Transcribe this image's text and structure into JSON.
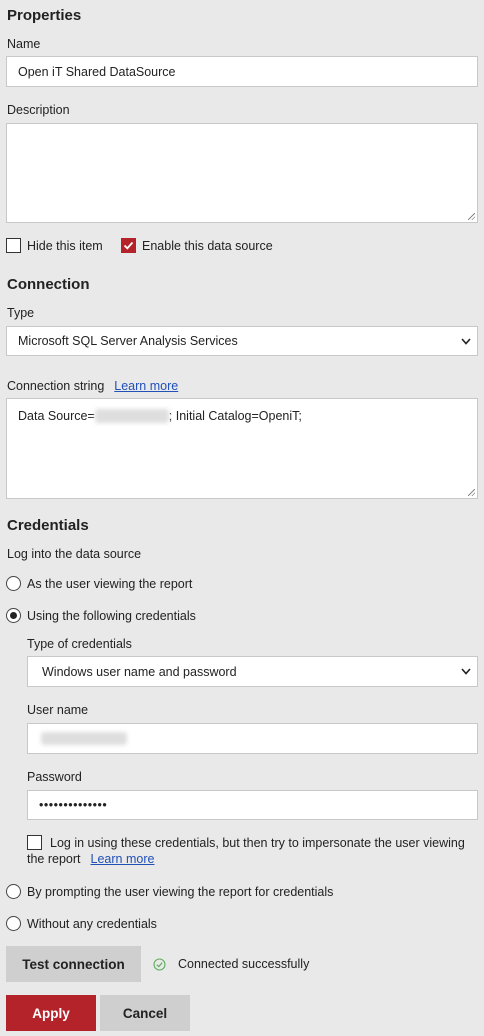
{
  "properties": {
    "heading": "Properties",
    "name_label": "Name",
    "name_value": "Open iT Shared DataSource",
    "description_label": "Description",
    "description_value": "",
    "hide_item_label": "Hide this item",
    "hide_item_checked": false,
    "enable_source_label": "Enable this data source",
    "enable_source_checked": true
  },
  "connection": {
    "heading": "Connection",
    "type_label": "Type",
    "type_value": "Microsoft SQL Server Analysis Services",
    "conn_string_label": "Connection string",
    "learn_more": "Learn more",
    "conn_string_prefix": "Data Source=",
    "conn_string_suffix": "; Initial Catalog=OpeniT;"
  },
  "credentials": {
    "heading": "Credentials",
    "login_label": "Log into the data source",
    "opt_viewing_user": "As the user viewing the report",
    "opt_following": "Using the following credentials",
    "opt_prompting": "By prompting the user viewing the report for credentials",
    "opt_none": "Without any credentials",
    "selected_option": "opt_following",
    "type_of_credentials_label": "Type of credentials",
    "type_of_credentials_value": "Windows user name and password",
    "user_name_label": "User name",
    "password_label": "Password",
    "password_value": "••••••••••••••",
    "impersonate_label": "Log in using these credentials, but then try to impersonate the user viewing",
    "impersonate_label_2": "the report",
    "impersonate_learn_more": "Learn more",
    "impersonate_checked": false
  },
  "actions": {
    "test_connection": "Test connection",
    "status": "Connected successfully",
    "apply": "Apply",
    "cancel": "Cancel"
  },
  "colors": {
    "accent": "#b4232a",
    "link": "#2150b6",
    "background": "#e9e9e9",
    "success": "#5cae5c"
  }
}
